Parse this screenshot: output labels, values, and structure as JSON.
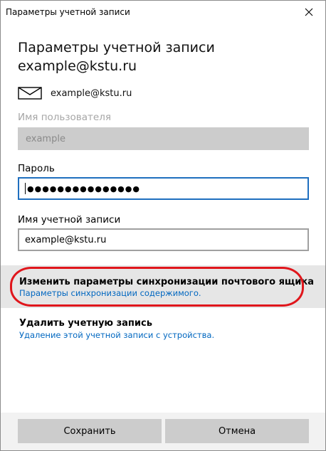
{
  "window": {
    "title": "Параметры учетной записи"
  },
  "heading": {
    "line1": "Параметры учетной записи",
    "line2": "example@kstu.ru"
  },
  "account": {
    "email": "example@kstu.ru",
    "icon": "mail-icon"
  },
  "username": {
    "label": "Имя пользователя",
    "value": "example"
  },
  "password": {
    "label": "Пароль",
    "masked": "●●●●●●●●●●●●●●●"
  },
  "account_name": {
    "label": "Имя учетной записи",
    "value": "example@kstu.ru"
  },
  "sync": {
    "title": "Изменить параметры синхронизации почтового ящика",
    "link": "Параметры синхронизации содержимого."
  },
  "remove": {
    "title": "Удалить учетную запись",
    "link": "Удаление этой учетной записи с устройства."
  },
  "buttons": {
    "save": "Сохранить",
    "cancel": "Отмена"
  },
  "colors": {
    "accent": "#0067c0",
    "focus_border": "#1f6fbf",
    "highlight": "#e0161c"
  }
}
